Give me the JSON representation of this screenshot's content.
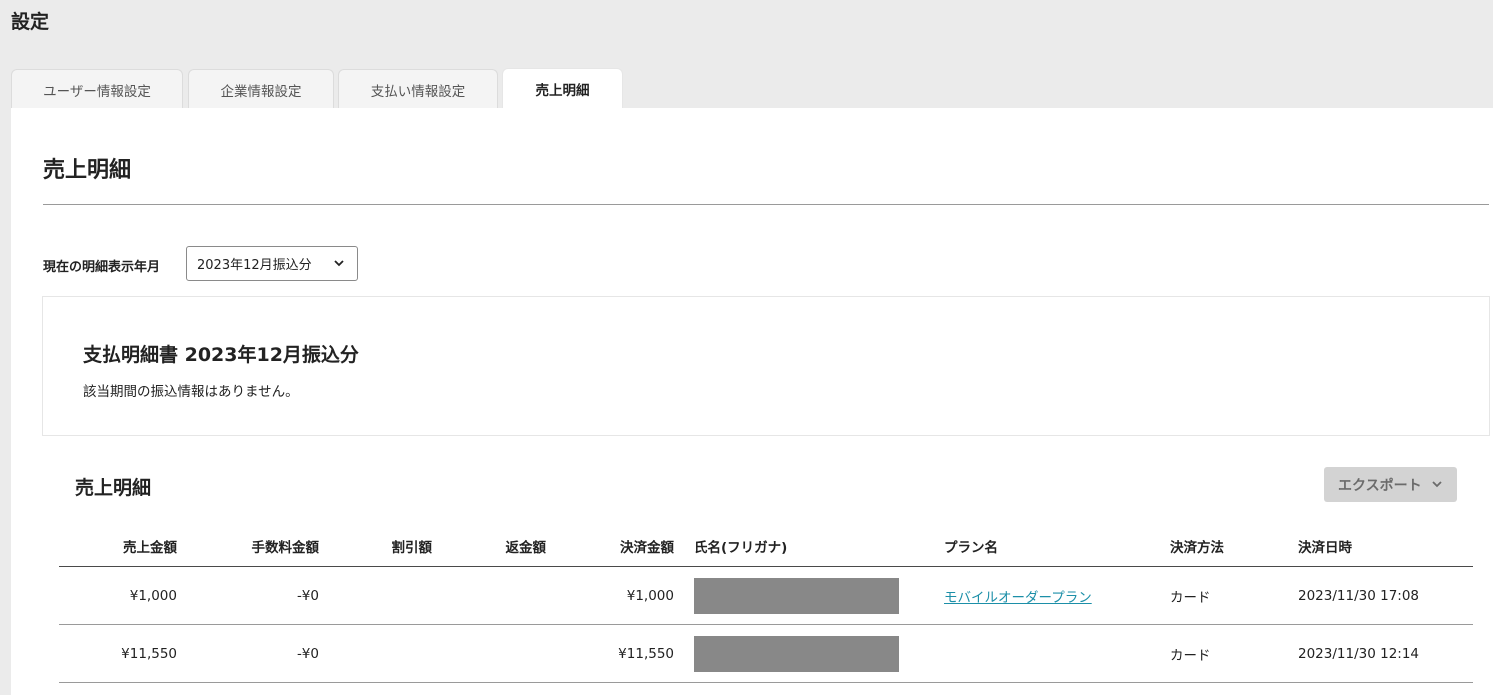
{
  "page": {
    "title": "設定"
  },
  "tabs": [
    {
      "label": "ユーザー情報設定",
      "active": false
    },
    {
      "label": "企業情報設定",
      "active": false
    },
    {
      "label": "支払い情報設定",
      "active": false
    },
    {
      "label": "売上明細",
      "active": true
    }
  ],
  "section": {
    "title": "売上明細"
  },
  "period": {
    "label": "現在の明細表示年月",
    "selected": "2023年12月振込分"
  },
  "statement": {
    "title": "支払明細書 2023年12月振込分",
    "message": "該当期間の振込情報はありません。"
  },
  "sales": {
    "title": "売上明細",
    "export_label": "エクスポート",
    "columns": [
      "売上金額",
      "手数料金額",
      "割引額",
      "返金額",
      "決済金額",
      "氏名(フリガナ)",
      "プラン名",
      "決済方法",
      "決済日時"
    ],
    "rows": [
      {
        "sales": "¥1,000",
        "fee": "-¥0",
        "discount": "",
        "refund": "",
        "payment": "¥1,000",
        "name": "",
        "plan": "モバイルオーダープラン",
        "method": "カード",
        "datetime": "2023/11/30 17:08"
      },
      {
        "sales": "¥11,550",
        "fee": "-¥0",
        "discount": "",
        "refund": "",
        "payment": "¥11,550",
        "name": "",
        "plan": "",
        "method": "カード",
        "datetime": "2023/11/30 12:14"
      }
    ]
  },
  "icons": {
    "select_chevron": "chevron-down-icon",
    "export_chevron": "chevron-down-icon"
  },
  "colors": {
    "link": "#1c8fa8",
    "export_bg": "#d3d3d3",
    "redaction": "#888888"
  }
}
